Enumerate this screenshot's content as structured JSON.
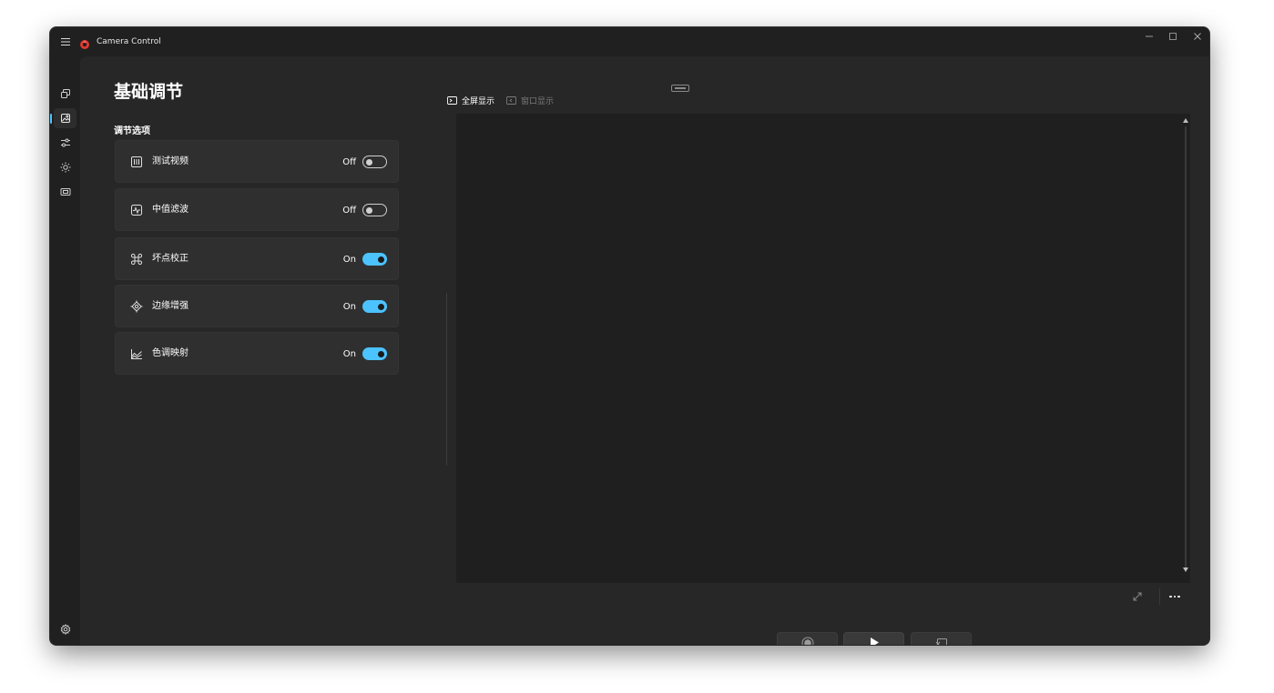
{
  "window": {
    "app_title": "Camera Control",
    "controls": [
      "minimize-icon",
      "maximize-icon",
      "close-icon"
    ]
  },
  "rail": {
    "items": [
      "gallery-icon",
      "image-adjust-icon",
      "sliders-icon",
      "brightness-icon",
      "film-frame-icon"
    ],
    "active_index": 1,
    "footer": "settings-gear-icon"
  },
  "page": {
    "title": "基础调节",
    "section": "调节选项"
  },
  "options": [
    {
      "label": "测试视频",
      "state": "Off",
      "on": false,
      "icon": "test-video-icon"
    },
    {
      "label": "中值滤波",
      "state": "Off",
      "on": false,
      "icon": "median-filter-icon"
    },
    {
      "label": "坏点校正",
      "state": "On",
      "on": true,
      "icon": "command-icon"
    },
    {
      "label": "边缘增强",
      "state": "On",
      "on": true,
      "icon": "edge-target-icon"
    },
    {
      "label": "色调映射",
      "state": "On",
      "on": true,
      "icon": "tone-chart-icon"
    }
  ],
  "view_tabs": {
    "fullscreen": "全屏显示",
    "windowed": "窗口显示",
    "active": "fullscreen"
  },
  "controls": {
    "record": "record-icon",
    "play": "play-icon",
    "snapshot": "snapshot-icon",
    "expand": "expand-icon",
    "more": "more-icon"
  },
  "colors": {
    "accent": "#4cc2ff",
    "window_bg": "#202020",
    "content_bg": "#272727",
    "card_bg": "#2f2f2f",
    "logo_red": "#e03a2f"
  }
}
